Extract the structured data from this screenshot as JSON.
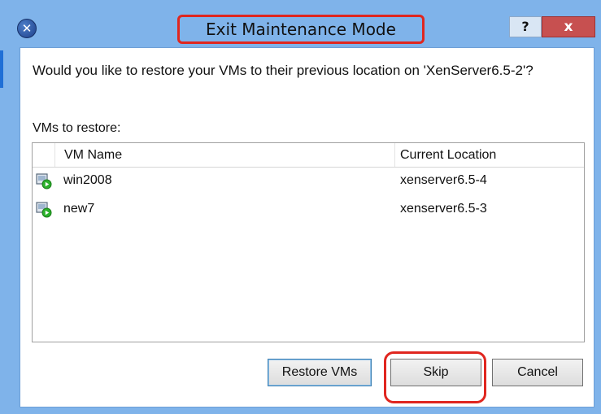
{
  "dialog": {
    "title": "Exit Maintenance Mode",
    "help_label": "?",
    "close_label": "x",
    "prompt": "Would you like to restore your VMs to their previous location on 'XenServer6.5-2'?",
    "vms_label": "VMs to restore:"
  },
  "grid": {
    "columns": [
      "VM Name",
      "Current Location"
    ],
    "rows": [
      {
        "name": "win2008",
        "location": "xenserver6.5-4",
        "icon": "vm-running-icon"
      },
      {
        "name": "new7",
        "location": "xenserver6.5-3",
        "icon": "vm-running-icon"
      }
    ]
  },
  "buttons": {
    "restore_label": "Restore VMs",
    "skip_label": "Skip",
    "cancel_label": "Cancel"
  },
  "colors": {
    "frame": "#7fb3ea",
    "highlight": "#e0261f",
    "close": "#c75050",
    "running": "#2bb12b"
  }
}
